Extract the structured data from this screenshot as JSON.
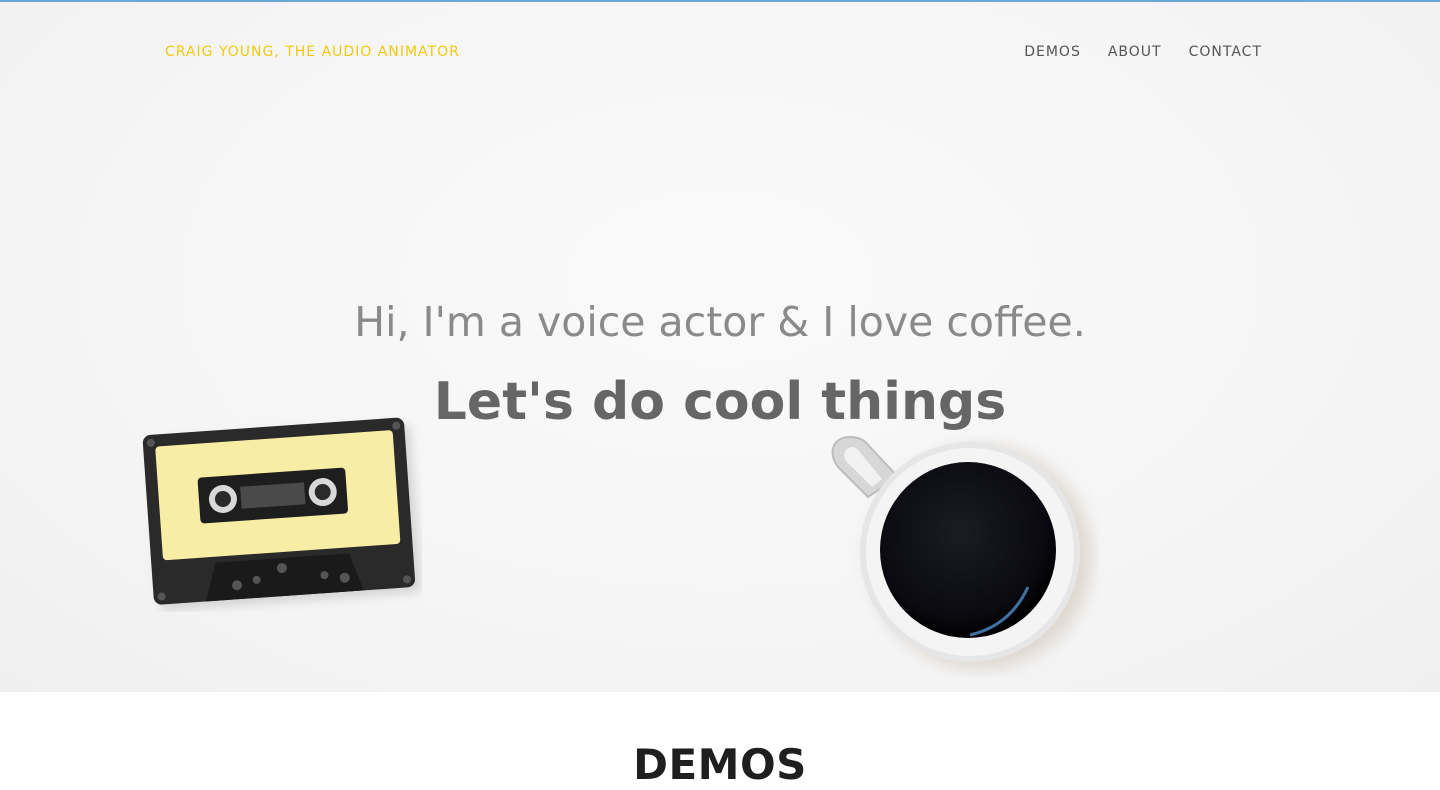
{
  "header": {
    "brand": "CRAIG YOUNG, THE AUDIO ANIMATOR",
    "nav": [
      {
        "label": "DEMOS"
      },
      {
        "label": "ABOUT"
      },
      {
        "label": "CONTACT"
      }
    ]
  },
  "hero": {
    "subtitle": "Hi, I'm a voice actor & I love coffee.",
    "headline": "Let's do cool things"
  },
  "demos": {
    "title": "DEMOS"
  },
  "colors": {
    "brand": "#f2c811",
    "nav_text": "#555555",
    "headline": "#666666"
  }
}
